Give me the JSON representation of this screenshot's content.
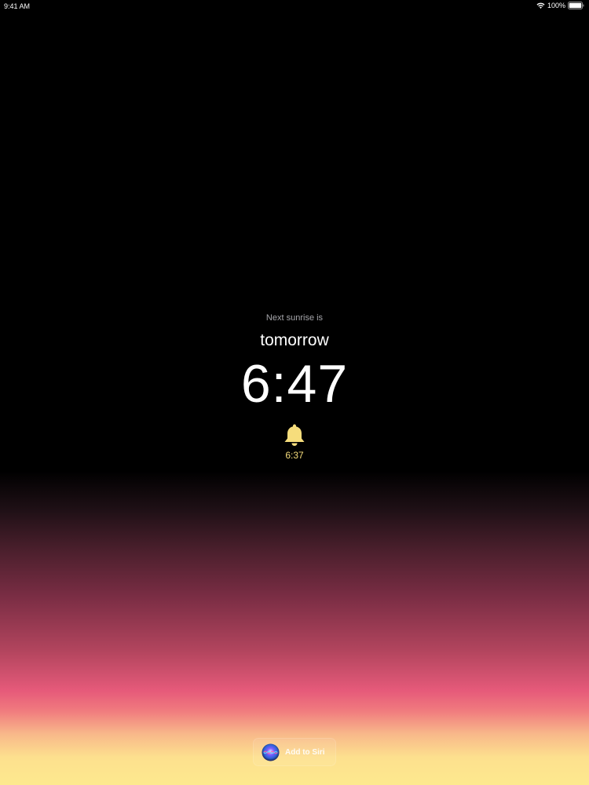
{
  "status_bar": {
    "time": "9:41 AM",
    "battery": "100%"
  },
  "main": {
    "caption": "Next sunrise is",
    "day": "tomorrow",
    "sunrise_time": "6:47",
    "alarm_time": "6:37"
  },
  "siri": {
    "label": "Add to Siri"
  },
  "colors": {
    "background_top": "#000000",
    "gradient_mid": "#e65a7a",
    "gradient_bottom": "#fde98e",
    "alarm_accent": "#f6dd7c"
  },
  "icons": {
    "status": [
      "wifi-icon",
      "battery-icon"
    ],
    "alarm": "bell-icon",
    "siri": "siri-icon"
  }
}
